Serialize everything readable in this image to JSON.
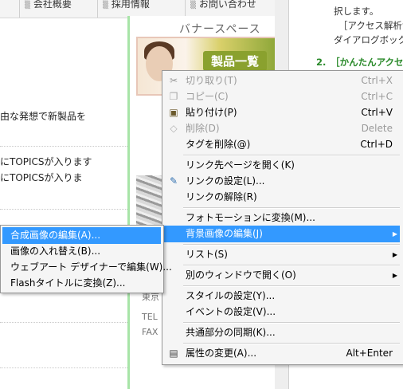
{
  "nav": {
    "items": [
      "会社概要",
      "採用情報",
      "お問い合わせ"
    ]
  },
  "page": {
    "text_lines": [
      "由な発想で新製品を",
      "にTOPICSが入ります",
      "にTOPICSが入りま"
    ]
  },
  "banner": {
    "title": "バナースペース",
    "product_label": "製品一覧",
    "side_text": [
      "東京",
      "TEL",
      "FAX"
    ]
  },
  "right_pane": {
    "lines": [
      "択します。",
      "［アクセス解析サ",
      "ダイアログボック",
      "2.　［かんたんアクセ"
    ]
  },
  "context_menu": {
    "items": [
      {
        "label": "切り取り(T)",
        "shortcut": "Ctrl+X",
        "disabled": true,
        "icon": "scissors-icon"
      },
      {
        "label": "コピー(C)",
        "shortcut": "Ctrl+C",
        "disabled": true,
        "icon": "copy-icon"
      },
      {
        "label": "貼り付け(P)",
        "shortcut": "Ctrl+V",
        "disabled": false,
        "icon": "paste-icon"
      },
      {
        "label": "削除(D)",
        "shortcut": "Delete",
        "disabled": true,
        "icon": "eraser-icon"
      },
      {
        "label": "タグを削除(@)",
        "shortcut": "Ctrl+D",
        "disabled": false
      },
      {
        "label": "リンク先ページを開く(K)",
        "shortcut": "",
        "disabled": false
      },
      {
        "label": "リンクの設定(L)...",
        "shortcut": "",
        "disabled": false,
        "icon": "link-edit-icon"
      },
      {
        "label": "リンクの解除(R)",
        "shortcut": "",
        "disabled": false
      },
      {
        "label": "フォトモーションに変換(M)...",
        "shortcut": "",
        "disabled": false
      },
      {
        "label": "背景画像の編集(J)",
        "shortcut": "",
        "disabled": false,
        "highlighted": true,
        "submenu": true
      },
      {
        "label": "リスト(S)",
        "shortcut": "",
        "disabled": false,
        "submenu": true
      },
      {
        "label": "別のウィンドウで開く(O)",
        "shortcut": "",
        "disabled": false,
        "submenu": true
      },
      {
        "label": "スタイルの設定(Y)...",
        "shortcut": "",
        "disabled": false
      },
      {
        "label": "イベントの設定(V)...",
        "shortcut": "",
        "disabled": false
      },
      {
        "label": "共通部分の同期(K)...",
        "shortcut": "",
        "disabled": false
      },
      {
        "label": "属性の変更(A)...",
        "shortcut": "Alt+Enter",
        "disabled": false,
        "icon": "properties-icon"
      }
    ]
  },
  "submenu": {
    "items": [
      {
        "label": "合成画像の編集(A)...",
        "highlighted": true
      },
      {
        "label": "画像の入れ替え(B)..."
      },
      {
        "label": "ウェブアート デザイナーで編集(W)..."
      },
      {
        "label": "Flashタイトルに変換(Z)..."
      }
    ]
  },
  "colors": {
    "highlight": "#3399ff",
    "banner_border": "#a8e4a8",
    "menu_bg": "#f5f5f5"
  }
}
